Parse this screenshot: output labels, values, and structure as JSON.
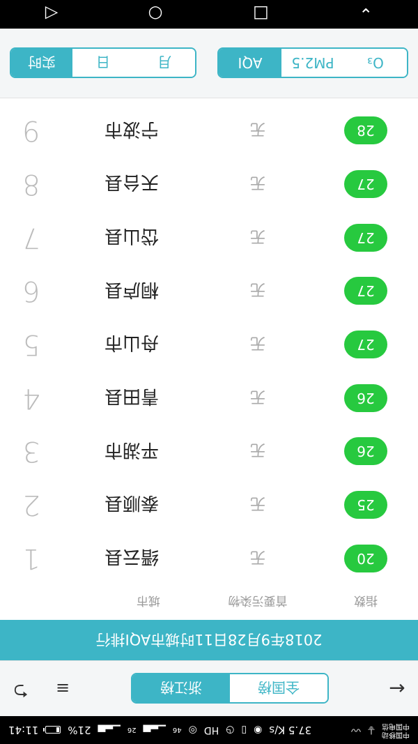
{
  "status_bar": {
    "carrier_1": "中国移动",
    "carrier_2": "中国电信",
    "net_speed": "37.5 K/s",
    "signal_1": "46",
    "signal_2": "26",
    "battery": "21%",
    "time": "11:41"
  },
  "toolbar": {
    "tab_zhejiang": "浙江榜",
    "tab_national": "全国榜"
  },
  "banner": {
    "title": "2018年9月28日11时城市AQI排行"
  },
  "columns": {
    "city": "城市",
    "pollutant": "首要污染物",
    "index": "指数"
  },
  "rows": [
    {
      "rank": "1",
      "city": "缙云县",
      "pollutant": "无",
      "aqi": "20"
    },
    {
      "rank": "2",
      "city": "泰顺县",
      "pollutant": "无",
      "aqi": "25"
    },
    {
      "rank": "3",
      "city": "平湖市",
      "pollutant": "无",
      "aqi": "26"
    },
    {
      "rank": "4",
      "city": "青田县",
      "pollutant": "无",
      "aqi": "26"
    },
    {
      "rank": "5",
      "city": "舟山市",
      "pollutant": "无",
      "aqi": "27"
    },
    {
      "rank": "6",
      "city": "桐庐县",
      "pollutant": "无",
      "aqi": "27"
    },
    {
      "rank": "7",
      "city": "岱山县",
      "pollutant": "无",
      "aqi": "27"
    },
    {
      "rank": "8",
      "city": "天台县",
      "pollutant": "无",
      "aqi": "27"
    },
    {
      "rank": "9",
      "city": "宁波市",
      "pollutant": "无",
      "aqi": "28"
    }
  ],
  "time_filter": {
    "realtime": "实时",
    "day": "日",
    "month": "月"
  },
  "metric_filter": {
    "aqi": "AQI",
    "pm25": "PM2.5",
    "o3": "O₃"
  },
  "colors": {
    "accent": "#3db5c6",
    "good": "#27c93f"
  }
}
